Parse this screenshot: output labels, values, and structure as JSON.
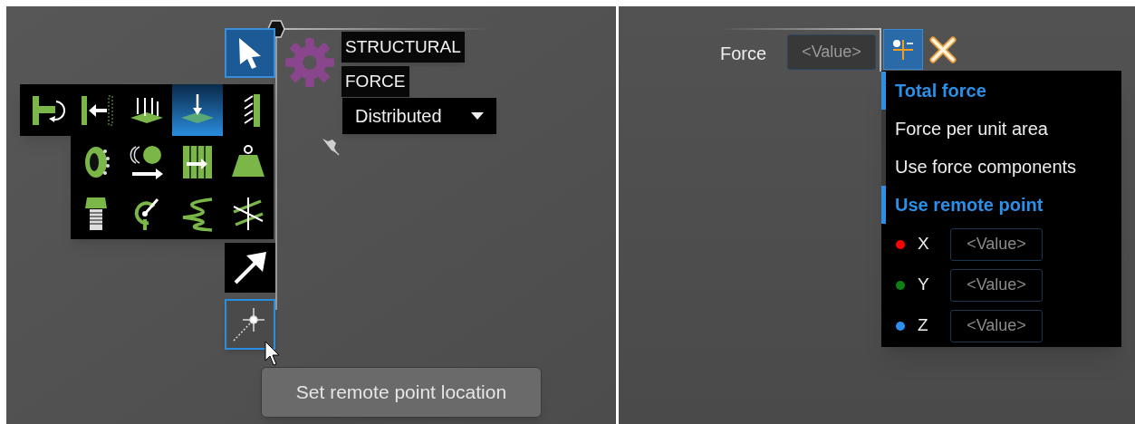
{
  "left_view": {
    "select_tool": {
      "selected": true
    },
    "title_lines": [
      "STRUCTURAL",
      "FORCE"
    ],
    "mode_dropdown": {
      "value": "Distributed"
    },
    "tool_palette": [
      [
        {
          "selected": false
        },
        {
          "selected": false
        },
        {
          "selected": false
        },
        {
          "selected": true
        },
        {
          "selected": false
        }
      ],
      [
        {
          "selected": false
        },
        {
          "selected": false
        },
        {
          "selected": false
        },
        {
          "selected": false
        }
      ],
      [
        {
          "selected": false
        },
        {
          "selected": false
        },
        {
          "selected": false
        },
        {
          "selected": false
        }
      ]
    ],
    "direction_tool": {
      "selected": false
    },
    "remote_point_tool": {
      "selected": true
    },
    "tooltip": "Set remote point location"
  },
  "right_view": {
    "force_label": "Force",
    "force_field": {
      "placeholder": "<Value>"
    },
    "options": [
      {
        "label": "Total force",
        "selected": true
      },
      {
        "label": "Force per unit area",
        "selected": false
      },
      {
        "label": "Use force components",
        "selected": false
      },
      {
        "label": "Use remote point",
        "selected": true
      }
    ],
    "components": [
      {
        "axis": "X",
        "color": "#ff0000",
        "placeholder": "<Value>"
      },
      {
        "axis": "Y",
        "color": "#108010",
        "placeholder": "<Value>"
      },
      {
        "axis": "Z",
        "color": "#2a8ff0",
        "placeholder": "<Value>"
      }
    ]
  }
}
